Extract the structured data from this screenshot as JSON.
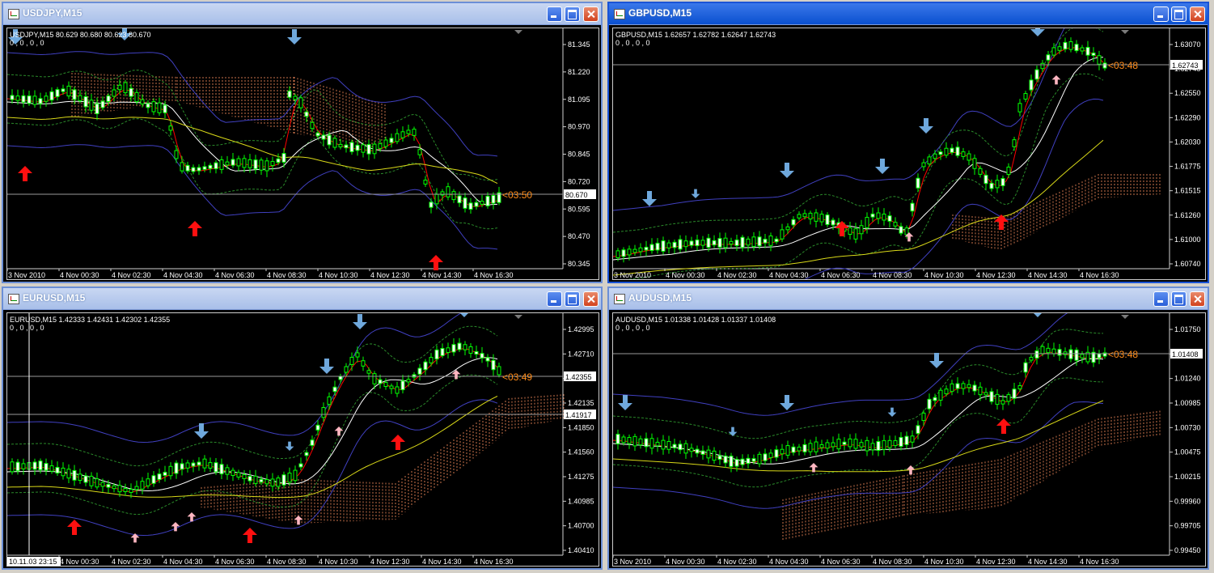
{
  "windows": [
    {
      "title": "USDJPY,M15",
      "header_line1": "USDJPY,M15  80.629 80.680 80.623 80.670",
      "header_line2": "0 , 0 , 0 , 0",
      "price_ticks": [
        "81.345",
        "81.220",
        "81.095",
        "80.970",
        "80.845",
        "80.720",
        "80.595",
        "80.470",
        "80.345"
      ],
      "price_label": "80.670",
      "countdown": "03:50",
      "time_ticks": [
        "3 Nov 2010",
        "4 Nov 00:30",
        "4 Nov 02:30",
        "4 Nov 04:30",
        "4 Nov 06:30",
        "4 Nov 08:30",
        "4 Nov 10:30",
        "4 Nov 12:30",
        "4 Nov 14:30",
        "4 Nov 16:30"
      ]
    },
    {
      "title": "GBPUSD,M15",
      "header_line1": "GBPUSD,M15  1.62657 1.62782 1.62647 1.62743",
      "header_line2": "0 , 0 , 0 , 0",
      "price_ticks": [
        "1.63070",
        "1.62743",
        "1.62550",
        "1.62290",
        "1.62030",
        "1.61775",
        "1.61515",
        "1.61260",
        "1.61000",
        "1.60740"
      ],
      "price_label": "1.62743",
      "countdown": "03:48",
      "time_ticks": [
        "3 Nov 2010",
        "4 Nov 00:30",
        "4 Nov 02:30",
        "4 Nov 04:30",
        "4 Nov 06:30",
        "4 Nov 08:30",
        "4 Nov 10:30",
        "4 Nov 12:30",
        "4 Nov 14:30",
        "4 Nov 16:30"
      ]
    },
    {
      "title": "EURUSD,M15",
      "header_line1": "EURUSD,M15  1.42333 1.42431 1.42302 1.42355",
      "header_line2": "0 , 0 , 0 , 0",
      "price_ticks": [
        "1.42995",
        "1.42710",
        "1.42420",
        "1.42135",
        "1.41850",
        "1.41560",
        "1.41275",
        "1.40985",
        "1.40700",
        "1.40410"
      ],
      "price_label": "1.42355",
      "crosshair_label": "1.41917",
      "crosshair_time": "10.11.03 23:15",
      "countdown": "03:49",
      "time_ticks": [
        "4 Nov 00:30",
        "4 Nov 02:30",
        "4 Nov 04:30",
        "4 Nov 06:30",
        "4 Nov 08:30",
        "4 Nov 10:30",
        "4 Nov 12:30",
        "4 Nov 14:30",
        "4 Nov 16:30"
      ]
    },
    {
      "title": "AUDUSD,M15",
      "header_line1": "AUDUSD,M15  1.01338 1.01428 1.01337 1.01408",
      "header_line2": "0 , 0 , 0 , 0",
      "price_ticks": [
        "1.01750",
        "1.01495",
        "1.01240",
        "1.00985",
        "1.00730",
        "1.00475",
        "1.00215",
        "0.99960",
        "0.99705",
        "0.99450"
      ],
      "price_label": "1.01408",
      "countdown": "03:48",
      "time_ticks": [
        "3 Nov 2010",
        "4 Nov 00:30",
        "4 Nov 02:30",
        "4 Nov 04:30",
        "4 Nov 06:30",
        "4 Nov 08:30",
        "4 Nov 10:30",
        "4 Nov 12:30",
        "4 Nov 14:30",
        "4 Nov 16:30"
      ]
    }
  ],
  "colors": {
    "background": "#000000",
    "bull_candle": "#00ff00",
    "bear_candle": "#ffffff",
    "bollinger": "#4040c0",
    "envelope": "#2a8a2a",
    "fast_ma": "#ff0000",
    "mid_ma": "#ffffff",
    "slow_ma": "#d8d818",
    "cloud": "#ff9060",
    "buy_arrow": "#ff1010",
    "sell_arrow": "#6fa8dc",
    "countdown": "#ff8c1a"
  }
}
